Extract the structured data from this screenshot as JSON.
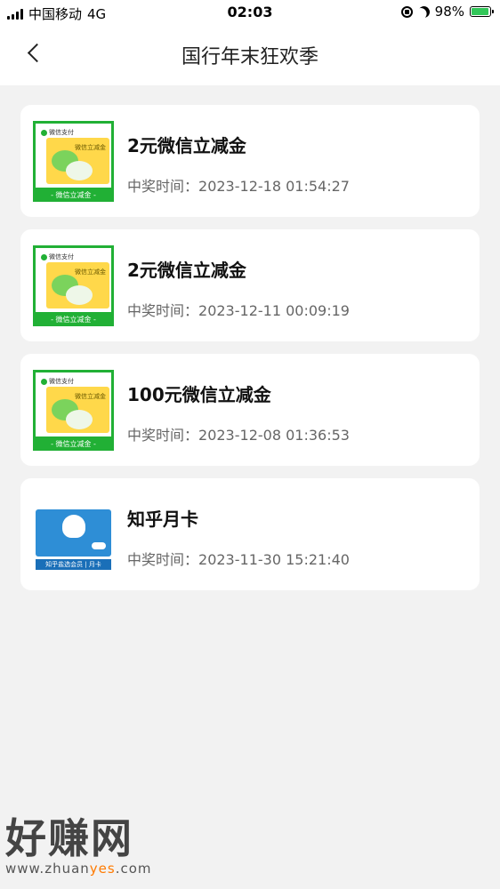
{
  "status_bar": {
    "carrier": "中国移动",
    "network": "4G",
    "time": "02:03",
    "battery": "98%"
  },
  "header": {
    "title": "国行年末狂欢季"
  },
  "prize_time_label": "中奖时间：",
  "prizes": [
    {
      "name": "2元微信立减金",
      "time": "2023-12-18 01:54:27",
      "thumb": "wechat-coupon"
    },
    {
      "name": "2元微信立减金",
      "time": "2023-12-11 00:09:19",
      "thumb": "wechat-coupon"
    },
    {
      "name": "100元微信立减金",
      "time": "2023-12-08 01:36:53",
      "thumb": "wechat-coupon"
    },
    {
      "name": "知乎月卡",
      "time": "2023-11-30 15:21:40",
      "thumb": "zhihu-card"
    }
  ],
  "thumb_text": {
    "wechat_pay": "微信支付",
    "wechat_coupon": "微信立减金",
    "wechat_footer": "- 微信立减金 -",
    "zhihu_footer": "知乎盐选会员 | 月卡"
  },
  "watermark": {
    "name": "好赚网",
    "url_prefix": "www.zhuan",
    "url_highlight": "yes",
    "url_suffix": ".com"
  },
  "colors": {
    "wechat_green": "#21b035",
    "coupon_yellow": "#ffd84a",
    "zhihu_blue": "#2e8ed6",
    "battery_green": "#32c759"
  }
}
